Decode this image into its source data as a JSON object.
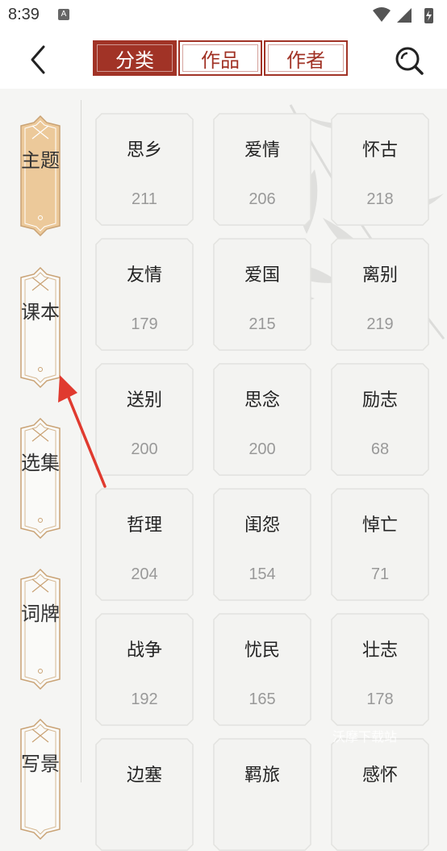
{
  "status_bar": {
    "time": "8:39",
    "notif_letter": "A"
  },
  "tabs": [
    {
      "label": "分类",
      "active": true
    },
    {
      "label": "作品",
      "active": false
    },
    {
      "label": "作者",
      "active": false
    }
  ],
  "sidebar": [
    {
      "label": "主题",
      "active": true
    },
    {
      "label": "课本",
      "active": false
    },
    {
      "label": "选集",
      "active": false
    },
    {
      "label": "词牌",
      "active": false
    },
    {
      "label": "写景",
      "active": false
    }
  ],
  "categories": [
    {
      "name": "思乡",
      "count": "211"
    },
    {
      "name": "爱情",
      "count": "206"
    },
    {
      "name": "怀古",
      "count": "218"
    },
    {
      "name": "友情",
      "count": "179"
    },
    {
      "name": "爱国",
      "count": "215"
    },
    {
      "name": "离别",
      "count": "219"
    },
    {
      "name": "送别",
      "count": "200"
    },
    {
      "name": "思念",
      "count": "200"
    },
    {
      "name": "励志",
      "count": "68"
    },
    {
      "name": "哲理",
      "count": "204"
    },
    {
      "name": "闺怨",
      "count": "154"
    },
    {
      "name": "悼亡",
      "count": "71"
    },
    {
      "name": "战争",
      "count": "192"
    },
    {
      "name": "忧民",
      "count": "165"
    },
    {
      "name": "壮志",
      "count": "178"
    },
    {
      "name": "边塞",
      "count": ""
    },
    {
      "name": "羁旅",
      "count": ""
    },
    {
      "name": "感怀",
      "count": ""
    }
  ],
  "watermark": "沃摩下载站",
  "colors": {
    "accent": "#a13326",
    "active_tab_bg": "#ecc99a",
    "page_bg": "#f5f5f3"
  }
}
